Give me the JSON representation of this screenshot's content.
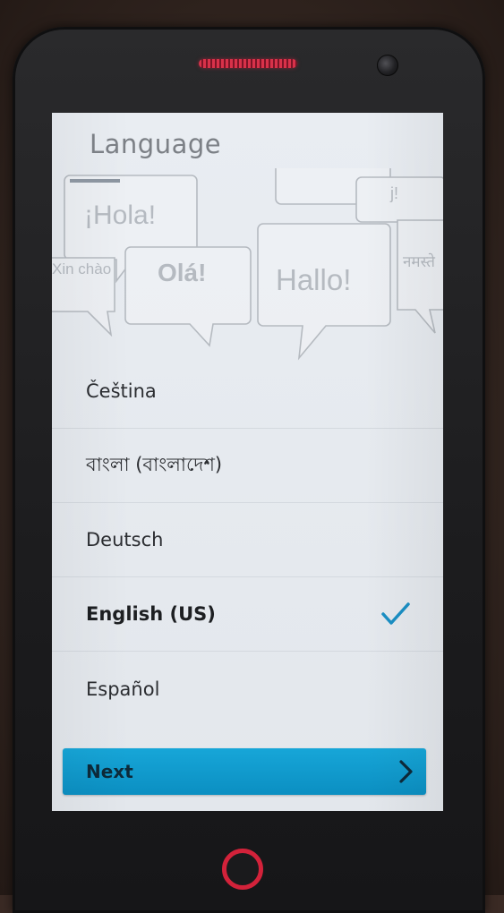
{
  "header": {
    "title": "Language"
  },
  "hero": {
    "greetings": [
      "¡Hola!",
      "Olá!",
      "Hallo!",
      "Xin chào",
      "नमस्ते",
      "j!"
    ]
  },
  "languages": [
    {
      "label": "Čeština",
      "selected": false
    },
    {
      "label": "বাংলা (বাংলাদেশ)",
      "selected": false
    },
    {
      "label": "Deutsch",
      "selected": false
    },
    {
      "label": "English (US)",
      "selected": true
    },
    {
      "label": "Español",
      "selected": false
    }
  ],
  "footer": {
    "next_label": "Next"
  },
  "colors": {
    "accent": "#0b8fc2",
    "check": "#1a8fc4",
    "hardware_led": "#d3223a"
  },
  "icons": {
    "selected": "checkmark-icon",
    "next": "chevron-right-icon"
  }
}
